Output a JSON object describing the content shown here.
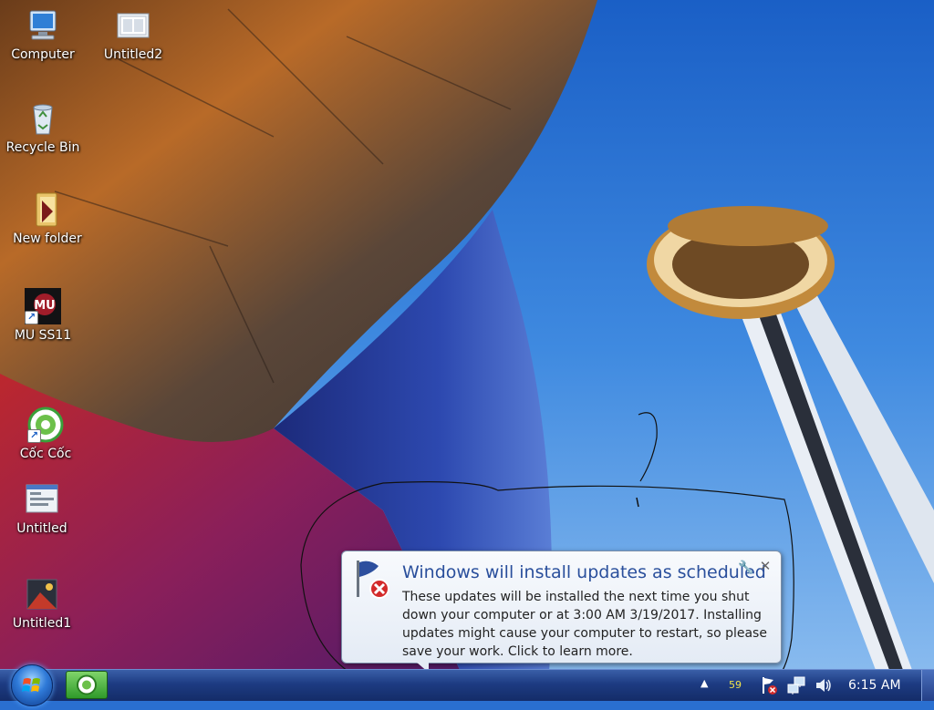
{
  "desktop": {
    "icons": [
      {
        "label": "Computer",
        "icon": "computer-icon"
      },
      {
        "label": "Untitled2",
        "icon": "document-icon"
      },
      {
        "label": "Recycle Bin",
        "icon": "recycle-bin-icon"
      },
      {
        "label": "New folder",
        "icon": "folder-icon"
      },
      {
        "label": "MU SS11",
        "icon": "mu-game-icon"
      },
      {
        "label": "Cốc Cốc",
        "icon": "coccoc-browser-icon"
      },
      {
        "label": "Untitled",
        "icon": "document-icon"
      },
      {
        "label": "Untitled1",
        "icon": "document-icon"
      }
    ]
  },
  "notification": {
    "title": "Windows will install updates as scheduled",
    "body": "These updates will be installed the next time you shut down your computer or at 3:00 AM 3/19/2017. Installing updates might cause your computer to restart, so please save your work. Click to learn more.",
    "icon": "windows-update-flag-icon"
  },
  "taskbar": {
    "tray_counter": "59",
    "clock": "6:15 AM",
    "tray_icons": [
      "show-hidden-icons-icon",
      "action-center-flag-icon",
      "network-icon",
      "volume-icon"
    ]
  }
}
